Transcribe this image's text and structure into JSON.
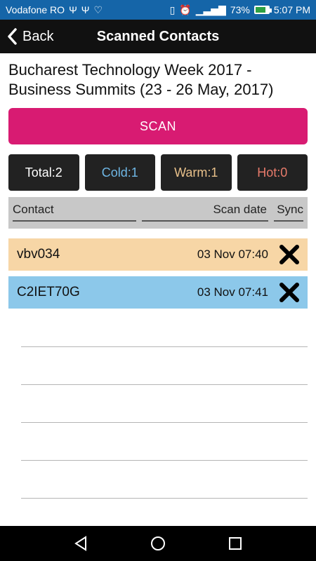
{
  "status": {
    "carrier": "Vodafone RO",
    "battery_text": "73%",
    "time": "5:07 PM",
    "left_icons": [
      "usb-icon",
      "usb-icon",
      "heart-monitor-icon"
    ],
    "right_icons": [
      "vibrate-icon",
      "alarm-icon",
      "4g-signal-icon",
      "battery-icon"
    ]
  },
  "app_bar": {
    "back_label": "Back",
    "title": "Scanned Contacts"
  },
  "event": {
    "title": "Bucharest Technology Week 2017 - Business Summits (23  - 26 May, 2017)"
  },
  "scan": {
    "label": "SCAN"
  },
  "counters": {
    "total": "Total:2",
    "cold": "Cold:1",
    "warm": "Warm:1",
    "hot": "Hot:0"
  },
  "table": {
    "headers": {
      "contact": "Contact",
      "scan_date": "Scan date",
      "sync": "Sync"
    },
    "rows": [
      {
        "name": "vbv034",
        "date": "03 Nov 07:40",
        "status": "warm"
      },
      {
        "name": "C2IET70G",
        "date": "03 Nov 07:41",
        "status": "cold"
      }
    ]
  },
  "colors": {
    "status_bar": "#1565a8",
    "app_bar": "#111111",
    "scan_button": "#d81b72",
    "warm_row": "#f7d6a6",
    "cold_row": "#8cc8ea",
    "cold_text": "#6fb7e5",
    "warm_text": "#e8c08a",
    "hot_text": "#e87b6b"
  }
}
